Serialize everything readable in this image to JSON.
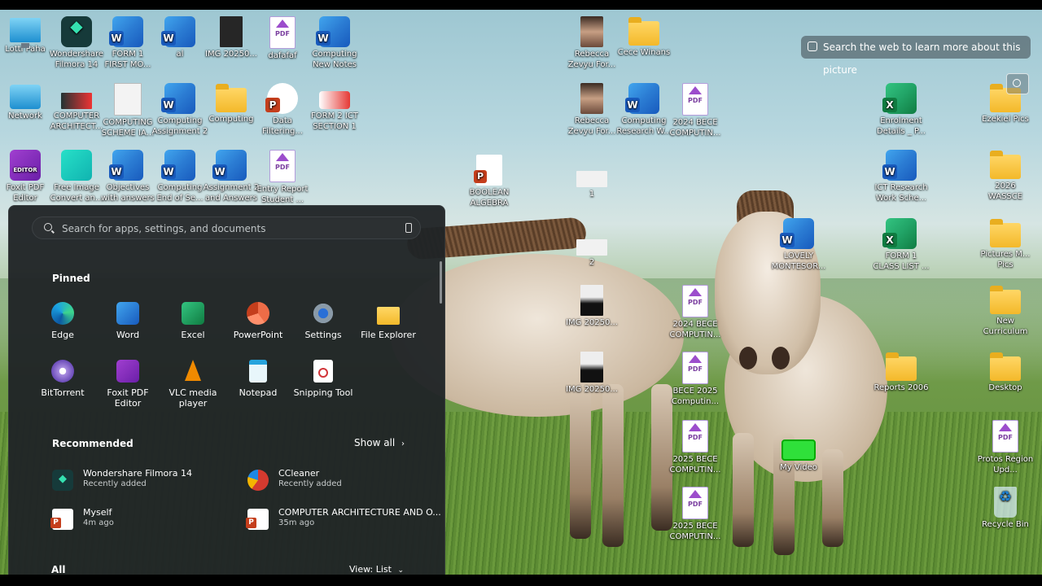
{
  "desktop": {
    "icons": [
      {
        "label": "Lotti Paha",
        "icon": "monitor-icon"
      },
      {
        "label": "Wondershare Filmora 14",
        "icon": "filmora-icon"
      },
      {
        "label": "FORM 1 FIRST MO...",
        "icon": "word-icon"
      },
      {
        "label": "al",
        "icon": "word-icon"
      },
      {
        "label": "IMG 20250...",
        "icon": "image-file-icon"
      },
      {
        "label": "dafafaf",
        "icon": "pdf-icon"
      },
      {
        "label": "Computing New Notes",
        "icon": "word-icon"
      },
      {
        "label": "Network",
        "icon": "network-icon"
      },
      {
        "label": "COMPUTER ARCHITECT...",
        "icon": "image-file-icon"
      },
      {
        "label": "COMPUTING SCHEME IA...",
        "icon": "document-icon"
      },
      {
        "label": "Computing Assignment 2",
        "icon": "word-icon"
      },
      {
        "label": "Computing",
        "icon": "folder-icon"
      },
      {
        "label": "Data Filtering...",
        "icon": "powerpoint-icon"
      },
      {
        "label": "FORM 2 ICT SECTION 1",
        "icon": "image-file-icon"
      },
      {
        "label": "Foxit PDF Editor",
        "icon": "foxit-icon"
      },
      {
        "label": "Free Image Convert an...",
        "icon": "image-convert-icon"
      },
      {
        "label": "Objectives with answers",
        "icon": "word-icon"
      },
      {
        "label": "Computing End of Se...",
        "icon": "word-icon"
      },
      {
        "label": "Assignment 2 and Answers",
        "icon": "word-icon"
      },
      {
        "label": "Entry Report Student ...",
        "icon": "pdf-icon"
      },
      {
        "label": "BOOLEAN ALGEBRA",
        "icon": "powerpoint-icon"
      },
      {
        "label": "Rebecca Zevyu For...",
        "icon": "photo-icon"
      },
      {
        "label": "Cece Winans",
        "icon": "folder-icon"
      },
      {
        "label": "Rebecca Zevyu For...",
        "icon": "photo-icon"
      },
      {
        "label": "Computing Research W...",
        "icon": "word-icon"
      },
      {
        "label": "2024 BECE COMPUTIN...",
        "icon": "pdf-icon"
      },
      {
        "label": "1",
        "icon": "image-file-icon"
      },
      {
        "label": "2",
        "icon": "image-file-icon"
      },
      {
        "label": "IMG 20250...",
        "icon": "image-file-icon"
      },
      {
        "label": "IMG 20250...",
        "icon": "image-file-icon"
      },
      {
        "label": "2024 BECE COMPUTIN...",
        "icon": "pdf-icon"
      },
      {
        "label": "BECE 2025 Computin...",
        "icon": "pdf-icon"
      },
      {
        "label": "2025 BECE COMPUTIN...",
        "icon": "pdf-icon"
      },
      {
        "label": "2025 BECE COMPUTIN...",
        "icon": "pdf-icon"
      },
      {
        "label": "LOVELY MONTESOR...",
        "icon": "word-icon"
      },
      {
        "label": "My Video",
        "icon": "video-icon"
      },
      {
        "label": "Enrolment Details _ P...",
        "icon": "excel-icon"
      },
      {
        "label": "ICT Research Work Sche...",
        "icon": "word-icon"
      },
      {
        "label": "FORM 1 CLASS LIST ...",
        "icon": "excel-icon"
      },
      {
        "label": "Reports 2006",
        "icon": "folder-icon"
      },
      {
        "label": "Ezekiel Pics",
        "icon": "folder-icon"
      },
      {
        "label": "2026 WASSCE",
        "icon": "folder-icon"
      },
      {
        "label": "Pictures M... Pics",
        "icon": "folder-icon"
      },
      {
        "label": "New Curriculum",
        "icon": "folder-icon"
      },
      {
        "label": "Desktop",
        "icon": "folder-icon"
      },
      {
        "label": "Protos Region Upd...",
        "icon": "pdf-icon"
      },
      {
        "label": "Recycle Bin",
        "icon": "recycle-bin-icon"
      }
    ],
    "visual_search": {
      "label": "Search the web to learn more about this picture"
    }
  },
  "start_menu": {
    "search_placeholder": "Search for apps, settings, and documents",
    "pinned_header": "Pinned",
    "pinned": [
      {
        "label": "Edge",
        "icon": "edge-icon"
      },
      {
        "label": "Word",
        "icon": "word-icon"
      },
      {
        "label": "Excel",
        "icon": "excel-icon"
      },
      {
        "label": "PowerPoint",
        "icon": "powerpoint-icon"
      },
      {
        "label": "Settings",
        "icon": "settings-icon"
      },
      {
        "label": "File Explorer",
        "icon": "file-explorer-icon"
      },
      {
        "label": "BitTorrent",
        "icon": "bittorrent-icon"
      },
      {
        "label": "Foxit PDF Editor",
        "icon": "foxit-icon"
      },
      {
        "label": "VLC media player",
        "icon": "vlc-icon"
      },
      {
        "label": "Notepad",
        "icon": "notepad-icon"
      },
      {
        "label": "Snipping Tool",
        "icon": "snipping-tool-icon"
      }
    ],
    "recommended_header": "Recommended",
    "show_all": "Show all",
    "recommended": [
      {
        "title": "Wondershare Filmora 14",
        "subtitle": "Recently added",
        "icon": "filmora-icon"
      },
      {
        "title": "CCleaner",
        "subtitle": "Recently added",
        "icon": "ccleaner-icon"
      },
      {
        "title": "Myself",
        "subtitle": "4m ago",
        "icon": "powerpoint-icon"
      },
      {
        "title": "COMPUTER ARCHITECTURE AND O...",
        "subtitle": "35m ago",
        "icon": "powerpoint-icon"
      }
    ],
    "all_header": "All",
    "view_mode": "View: List"
  }
}
